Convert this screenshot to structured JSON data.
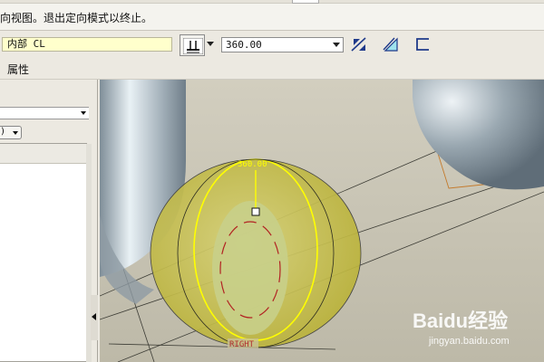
{
  "message_bar": {
    "text": "向视图。退出定向模式以终止。"
  },
  "dashboard": {
    "reference_field": "内部 CL",
    "depth_option_icon": "depth-option-icon",
    "angle_value": "360.00",
    "tool_icons": [
      "flip-direction-icon",
      "remove-material-icon",
      "thicken-sketch-icon"
    ]
  },
  "tabs": {
    "properties_label": "属性"
  },
  "viewport": {
    "dimension_label": "360.00",
    "sketch_plane_label": "RIGHT",
    "colors": {
      "background": "#c8c4b4",
      "torus": "#a9b6be",
      "preview_sphere": "#c9c24a",
      "highlight": "#ffff00",
      "dimension": "#b22222"
    }
  },
  "watermark": {
    "logo_text": "Baidu经验",
    "url": "jingyan.baidu.com"
  }
}
